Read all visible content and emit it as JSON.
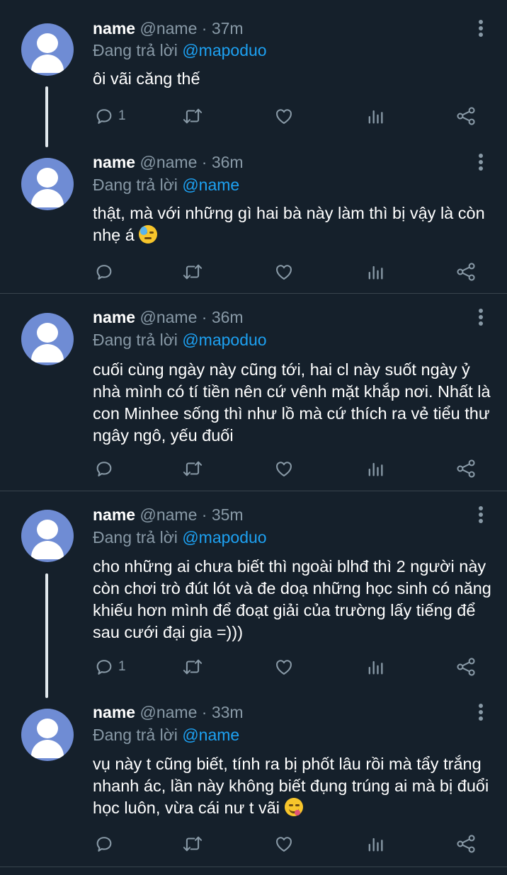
{
  "tweets": [
    {
      "name": "name",
      "handle": "@name",
      "time": "· 37m",
      "reply_prefix": "Đang trả lời",
      "reply_to": "@mapoduo",
      "text": "ôi vãi căng thế",
      "reply_count": "1"
    },
    {
      "name": "name",
      "handle": "@name",
      "time": "· 36m",
      "reply_prefix": "Đang trả lời",
      "reply_to": "@name",
      "text": "thật, mà với những gì hai bà này làm thì bị vậy là còn nhẹ á",
      "emoji": "sweat-face-icon",
      "reply_count": ""
    },
    {
      "name": "name",
      "handle": "@name",
      "time": "· 36m",
      "reply_prefix": "Đang trả lời",
      "reply_to": "@mapoduo",
      "text": "cuối cùng ngày này cũng tới, hai cl này suốt ngày ỷ nhà mình có tí tiền nên cứ vênh mặt khắp nơi. Nhất là con Minhee sống thì như lồ mà cứ thích ra vẻ tiểu thư ngây ngô, yếu đuối",
      "reply_count": ""
    },
    {
      "name": "name",
      "handle": "@name",
      "time": "· 35m",
      "reply_prefix": "Đang trả lời",
      "reply_to": "@mapoduo",
      "text": "cho những ai chưa biết thì ngoài blhđ thì 2 người này còn chơi trò đút lót và đe doạ những học sinh có năng khiếu hơn mình để đoạt giải của trường lấy tiếng để sau cưới đại gia =)))",
      "reply_count": "1"
    },
    {
      "name": "name",
      "handle": "@name",
      "time": "· 33m",
      "reply_prefix": "Đang trả lời",
      "reply_to": "@name",
      "text": "vụ này t cũng biết, tính ra bị phốt lâu rồi mà tẩy trắng nhanh ác, lần này không biết đụng trúng ai mà bị đuổi học luôn, vừa cái nư t vãi",
      "emoji": "yum-face-icon",
      "reply_count": ""
    }
  ],
  "colors": {
    "background": "#15202b",
    "secondary_text": "#8899a6",
    "mention": "#1da1f2",
    "divider": "#38444d",
    "avatar": "#6f8cd4"
  }
}
